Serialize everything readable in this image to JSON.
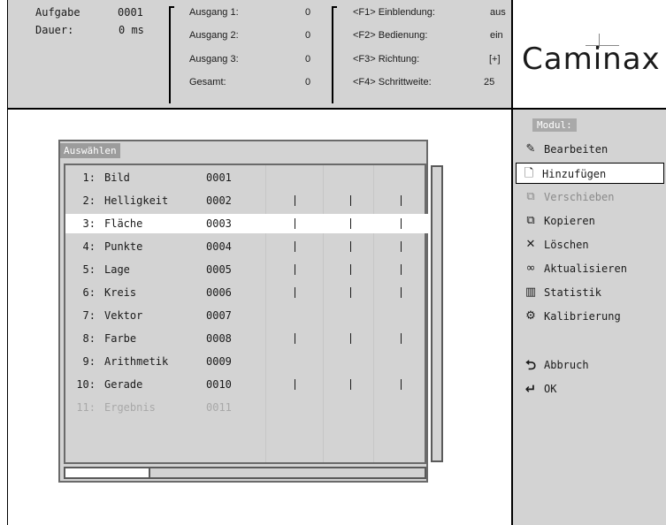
{
  "header": {
    "aufgabe_label": "Aufgabe",
    "aufgabe_value": "0001",
    "dauer_label": "Dauer:",
    "dauer_value": "0 ms",
    "ausgang": [
      {
        "label": "Ausgang 1:",
        "value": "0"
      },
      {
        "label": "Ausgang 2:",
        "value": "0"
      },
      {
        "label": "Ausgang 3:",
        "value": "0"
      },
      {
        "label": "Gesamt:",
        "value": "0"
      }
    ],
    "functions": [
      {
        "label": "<F1> Einblendung:",
        "value": "aus"
      },
      {
        "label": "<F2> Bedienung:",
        "value": "ein"
      },
      {
        "label": "<F3> Richtung:",
        "value": "[+]"
      },
      {
        "label": "<F4> Schrittweite:",
        "value": "25"
      }
    ]
  },
  "logo": {
    "text": "Caminax"
  },
  "dialog": {
    "title": "Auswählen",
    "rows": [
      {
        "num": "1:",
        "name": "Bild",
        "code": "0001",
        "marks": [
          false,
          false,
          false
        ],
        "selected": false,
        "disabled": false
      },
      {
        "num": "2:",
        "name": "Helligkeit",
        "code": "0002",
        "marks": [
          true,
          true,
          true
        ],
        "selected": false,
        "disabled": false
      },
      {
        "num": "3:",
        "name": "Fläche",
        "code": "0003",
        "marks": [
          true,
          true,
          true
        ],
        "selected": true,
        "disabled": false
      },
      {
        "num": "4:",
        "name": "Punkte",
        "code": "0004",
        "marks": [
          true,
          true,
          true
        ],
        "selected": false,
        "disabled": false
      },
      {
        "num": "5:",
        "name": "Lage",
        "code": "0005",
        "marks": [
          true,
          true,
          true
        ],
        "selected": false,
        "disabled": false
      },
      {
        "num": "6:",
        "name": "Kreis",
        "code": "0006",
        "marks": [
          true,
          true,
          true
        ],
        "selected": false,
        "disabled": false
      },
      {
        "num": "7:",
        "name": "Vektor",
        "code": "0007",
        "marks": [
          false,
          false,
          false
        ],
        "selected": false,
        "disabled": false
      },
      {
        "num": "8:",
        "name": "Farbe",
        "code": "0008",
        "marks": [
          true,
          true,
          true
        ],
        "selected": false,
        "disabled": false
      },
      {
        "num": "9:",
        "name": "Arithmetik",
        "code": "0009",
        "marks": [
          false,
          false,
          false
        ],
        "selected": false,
        "disabled": false
      },
      {
        "num": "10:",
        "name": "Gerade",
        "code": "0010",
        "marks": [
          true,
          true,
          true
        ],
        "selected": false,
        "disabled": false
      },
      {
        "num": "11:",
        "name": "Ergebnis",
        "code": "0011",
        "marks": [
          false,
          false,
          false
        ],
        "selected": false,
        "disabled": true
      }
    ]
  },
  "menu": {
    "heading": "Modul:",
    "items": [
      {
        "label": "Bearbeiten",
        "icon": "pencil-icon",
        "glyph": "✎",
        "active": false,
        "disabled": false
      },
      {
        "label": "Hinzufügen",
        "icon": "new-document-icon",
        "glyph": "🗋",
        "active": true,
        "disabled": false
      },
      {
        "label": "Verschieben",
        "icon": "move-icon",
        "glyph": "⧉",
        "active": false,
        "disabled": true
      },
      {
        "label": "Kopieren",
        "icon": "copy-icon",
        "glyph": "⧉",
        "active": false,
        "disabled": false
      },
      {
        "label": "Löschen",
        "icon": "delete-x-icon",
        "glyph": "✕",
        "active": false,
        "disabled": false
      },
      {
        "label": "Aktualisieren",
        "icon": "glasses-icon",
        "glyph": "∞",
        "active": false,
        "disabled": false
      },
      {
        "label": "Statistik",
        "icon": "bar-chart-icon",
        "glyph": "▥",
        "active": false,
        "disabled": false
      },
      {
        "label": "Kalibrierung",
        "icon": "calibration-icon",
        "glyph": "⚙",
        "active": false,
        "disabled": false
      }
    ],
    "actions": [
      {
        "label": "Abbruch",
        "icon": "abort-icon",
        "glyph": "⮌"
      },
      {
        "label": "OK",
        "icon": "ok-return-icon",
        "glyph": "↵"
      }
    ]
  }
}
